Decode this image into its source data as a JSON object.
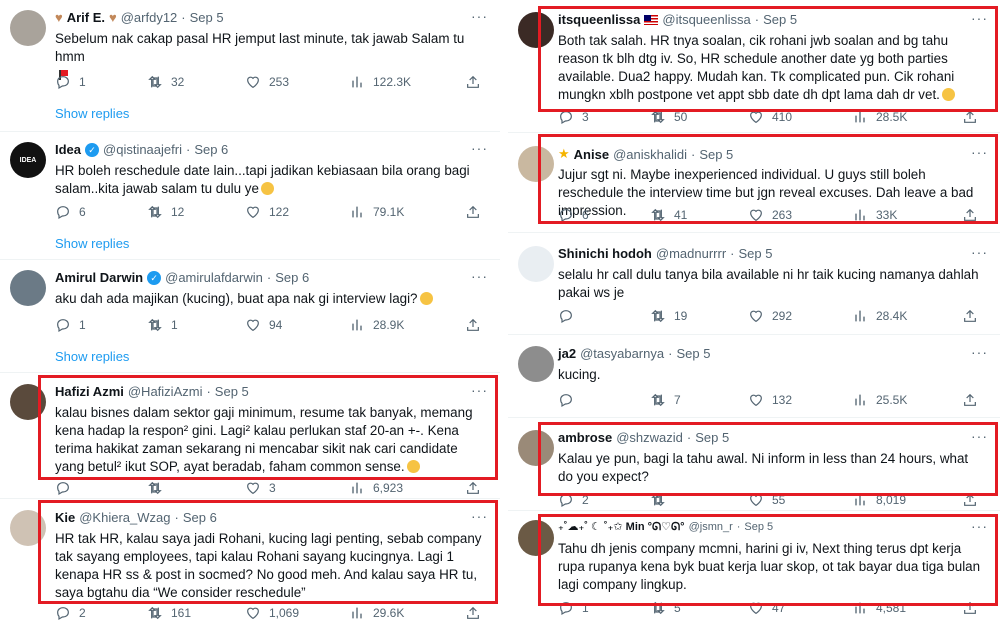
{
  "left": {
    "tweets": [
      {
        "name": "Arif E.",
        "handle": "@arfdy12",
        "date": "Sep 5",
        "text": "Sebelum nak cakap pasal HR jemput last minute, tak jawab Salam tu hmm",
        "replies": "1",
        "retweets": "32",
        "likes": "253",
        "views": "122.3K",
        "show_replies": "Show replies"
      },
      {
        "name": "Idea",
        "handle": "@qistinaajefri",
        "date": "Sep 6",
        "text": "HR boleh reschedule date lain...tapi jadikan kebiasaan bila orang bagi salam..kita jawab salam tu dulu ye",
        "replies": "6",
        "retweets": "12",
        "likes": "122",
        "views": "79.1K",
        "show_replies": "Show replies",
        "avatar_text": "IDEA"
      },
      {
        "name": "Amirul Darwin",
        "handle": "@amirulafdarwin",
        "date": "Sep 6",
        "text": "aku dah ada majikan (kucing), buat apa nak gi interview lagi?",
        "replies": "1",
        "retweets": "1",
        "likes": "94",
        "views": "28.9K",
        "show_replies": "Show replies"
      },
      {
        "name": "Hafizi Azmi",
        "handle": "@HafiziAzmi",
        "date": "Sep 5",
        "text": "kalau bisnes dalam sektor gaji minimum, resume tak banyak, memang kena hadap la respon² gini. Lagi² kalau perlukan staf 20-an +-. Kena terima hakikat zaman sekarang ni mencabar sikit nak cari candidate yang betul² ikut SOP, ayat beradab, faham common sense.",
        "replies": "",
        "retweets": "",
        "likes": "3",
        "views": "6,923"
      },
      {
        "name": "Kie",
        "handle": "@Khiera_Wzag",
        "date": "Sep 6",
        "text": "HR tak HR, kalau saya jadi Rohani, kucing lagi penting, sebab company tak sayang employees, tapi kalau Rohani sayang kucingnya. Lagi 1 kenapa HR ss & post in socmed? No good meh. And kalau saya HR tu, saya bgtahu dia “We consider reschedule”",
        "replies": "2",
        "retweets": "161",
        "likes": "1,069",
        "views": "29.6K"
      }
    ]
  },
  "right": {
    "tweets": [
      {
        "name": "itsqueenlissa",
        "handle": "@itsqueenlissa",
        "date": "Sep 5",
        "text": "Both tak salah. HR tnya soalan, cik rohani jwb soalan and bg tahu reason tk blh dtg iv. So, HR schedule another date yg both parties available. Dua2 happy. Mudah kan. Tk complicated pun. Cik rohani mungkn xblh postpone vet appt sbb date dh dpt lama dah dr vet.",
        "replies": "3",
        "retweets": "50",
        "likes": "410",
        "views": "28.5K"
      },
      {
        "name": "Anise",
        "handle": "@aniskhalidi",
        "date": "Sep 5",
        "text": "Jujur sgt ni. Maybe inexperienced individual. U guys still boleh reschedule the interview time but jgn reveal excuses. Dah leave a bad impression.",
        "replies": "6",
        "retweets": "41",
        "likes": "263",
        "views": "33K"
      },
      {
        "name": "Shinichi hodoh",
        "handle": "@madnurrrr",
        "date": "Sep 5",
        "text": "selalu hr call dulu tanya bila available ni hr taik kucing namanya dahlah pakai ws je",
        "replies": "",
        "retweets": "19",
        "likes": "292",
        "views": "28.4K"
      },
      {
        "name": "ja2",
        "handle": "@tasyabarnya",
        "date": "Sep 5",
        "text": "kucing.",
        "replies": "",
        "retweets": "7",
        "likes": "132",
        "views": "25.5K"
      },
      {
        "name": "ambrose",
        "handle": "@shzwazid",
        "date": "Sep 5",
        "text": "Kalau ye pun, bagi la tahu awal. Ni inform in less than 24 hours, what do you expect?",
        "replies": "2",
        "retweets": "",
        "likes": "55",
        "views": "8,019"
      },
      {
        "name": "₊˚☁︎₊˚ ☾ ˚₊✩ Min °ᘏ♡ᘏ°",
        "handle": "@jsmn_r",
        "date": "Sep 5",
        "text": "Tahu dh jenis company mcmni, harini gi iv, Next thing terus dpt kerja rupa rupanya kena byk buat kerja luar skop, ot tak bayar dua tiga bulan lagi company lingkup.",
        "replies": "1",
        "retweets": "5",
        "likes": "47",
        "views": "4,581"
      }
    ]
  },
  "colors": {
    "accent": "#1d9bf0",
    "highlight": "#e31b23",
    "muted": "#536471"
  }
}
